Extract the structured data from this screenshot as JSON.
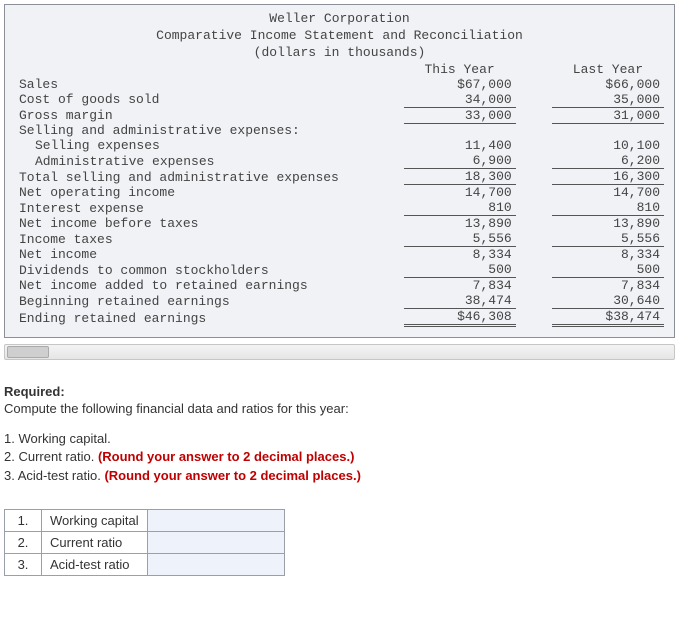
{
  "statement": {
    "company": "Weller Corporation",
    "title": "Comparative Income Statement and Reconciliation",
    "units": "(dollars in thousands)",
    "col_this": "This Year",
    "col_last": "Last Year",
    "rows": [
      {
        "label": "Sales",
        "this": "$67,000",
        "last": "$66,000",
        "indent": 0,
        "rule": "none"
      },
      {
        "label": "Cost of goods sold",
        "this": "34,000",
        "last": "35,000",
        "indent": 0,
        "rule": "ul"
      },
      {
        "label": "Gross margin",
        "this": "33,000",
        "last": "31,000",
        "indent": 0,
        "rule": "ul"
      },
      {
        "label": "Selling and administrative expenses:",
        "this": "",
        "last": "",
        "indent": 0,
        "rule": "none"
      },
      {
        "label": "Selling expenses",
        "this": "11,400",
        "last": "10,100",
        "indent": 1,
        "rule": "none"
      },
      {
        "label": "Administrative expenses",
        "this": "6,900",
        "last": "6,200",
        "indent": 1,
        "rule": "ul"
      },
      {
        "label": "Total selling and administrative expenses",
        "this": "18,300",
        "last": "16,300",
        "indent": 0,
        "rule": "ul"
      },
      {
        "label": "Net operating income",
        "this": "14,700",
        "last": "14,700",
        "indent": 0,
        "rule": "none"
      },
      {
        "label": "Interest expense",
        "this": "810",
        "last": "810",
        "indent": 0,
        "rule": "ul"
      },
      {
        "label": "Net income before taxes",
        "this": "13,890",
        "last": "13,890",
        "indent": 0,
        "rule": "none"
      },
      {
        "label": "Income taxes",
        "this": "5,556",
        "last": "5,556",
        "indent": 0,
        "rule": "ul"
      },
      {
        "label": "Net income",
        "this": "8,334",
        "last": "8,334",
        "indent": 0,
        "rule": "none"
      },
      {
        "label": "Dividends to common stockholders",
        "this": "500",
        "last": "500",
        "indent": 0,
        "rule": "ul"
      },
      {
        "label": "Net income added to retained earnings",
        "this": "7,834",
        "last": "7,834",
        "indent": 0,
        "rule": "none"
      },
      {
        "label": "Beginning retained earnings",
        "this": "38,474",
        "last": "30,640",
        "indent": 0,
        "rule": "ul"
      },
      {
        "label": "Ending retained earnings",
        "this": "$46,308",
        "last": "$38,474",
        "indent": 0,
        "rule": "dbl"
      }
    ]
  },
  "required": {
    "heading": "Required:",
    "prompt": "Compute the following financial data and ratios for this year:",
    "items": [
      {
        "n": "1.",
        "text": "Working capital.",
        "note": ""
      },
      {
        "n": "2.",
        "text": "Current ratio.",
        "note": "(Round your answer to 2 decimal places.)"
      },
      {
        "n": "3.",
        "text": "Acid-test ratio.",
        "note": "(Round your answer to 2 decimal places.)"
      }
    ]
  },
  "answer_table": {
    "rows": [
      {
        "n": "1.",
        "label": "Working capital",
        "value": ""
      },
      {
        "n": "2.",
        "label": "Current ratio",
        "value": ""
      },
      {
        "n": "3.",
        "label": "Acid-test ratio",
        "value": ""
      }
    ]
  }
}
